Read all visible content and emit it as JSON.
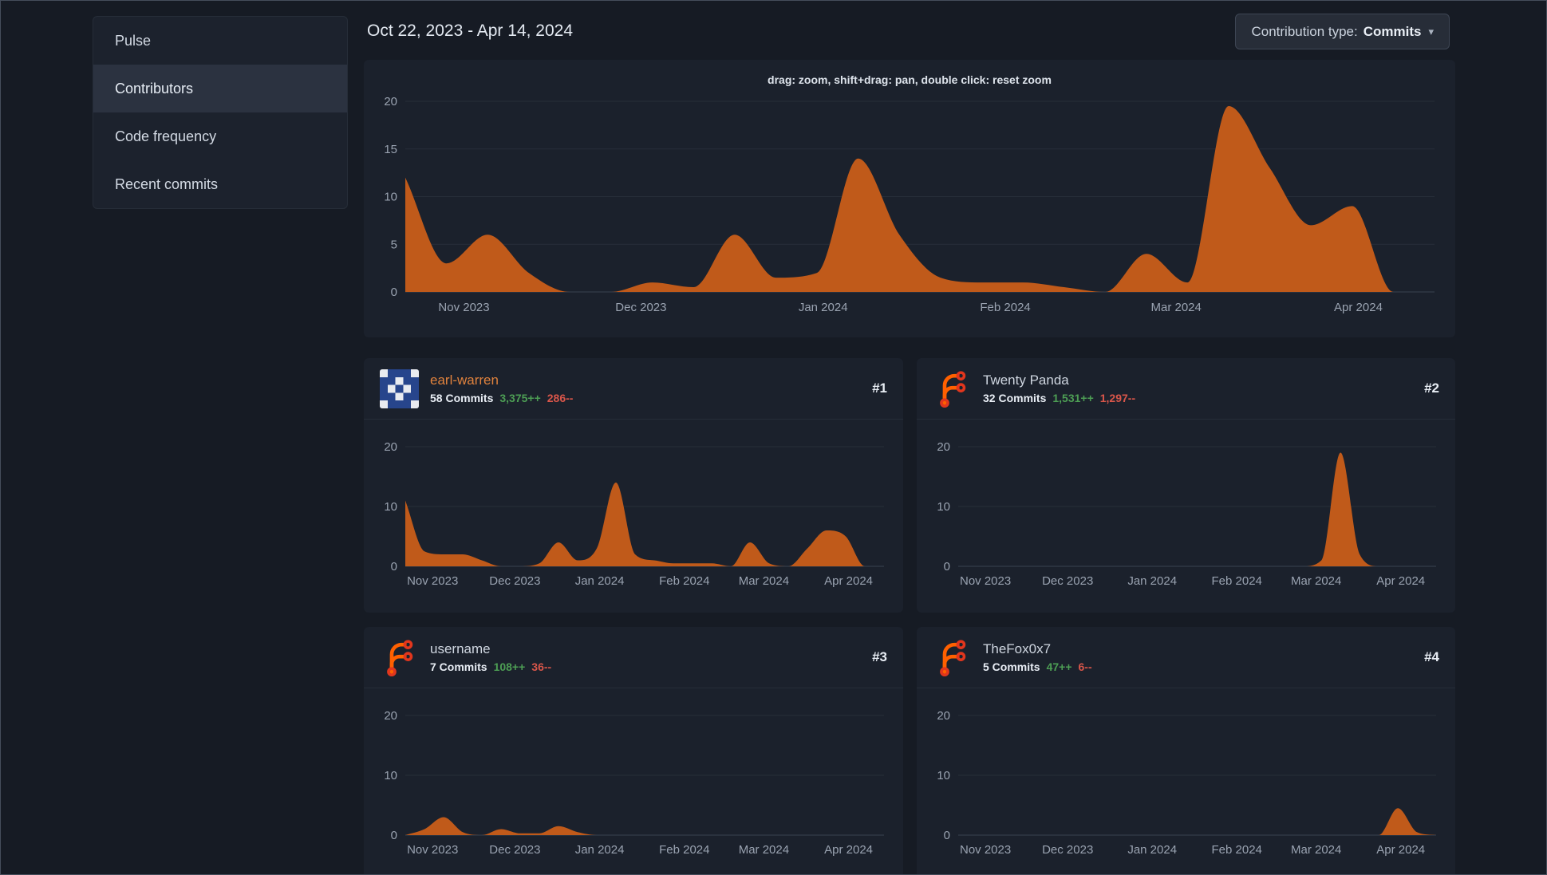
{
  "colors": {
    "page_bg": "#161b24",
    "card_bg": "#1b212c",
    "area": "#c05a1a",
    "grid_line": "#272e39",
    "axis_line": "#3a4250",
    "tick_text": "#9aa3b1",
    "additions_green": "#4d9e54",
    "deletions_red": "#d9564a"
  },
  "sidebar": {
    "items": [
      {
        "label": "Pulse",
        "active": false
      },
      {
        "label": "Contributors",
        "active": true
      },
      {
        "label": "Code frequency",
        "active": false
      },
      {
        "label": "Recent commits",
        "active": false
      }
    ]
  },
  "header": {
    "date_range": "Oct 22, 2023 - Apr 14, 2024",
    "contribution_type_label": "Contribution type:",
    "contribution_type_value": "Commits",
    "chevron_icon": "▾"
  },
  "chart_data": [
    {
      "id": "total-contributions",
      "type": "area",
      "hint": "drag: zoom, shift+drag: pan, double click: reset zoom",
      "week_start": "Oct 22, 2023",
      "week_end": "Apr 14, 2024",
      "x_tick_labels": [
        "Nov 2023",
        "Dec 2023",
        "Jan 2024",
        "Feb 2024",
        "Mar 2024",
        "Apr 2024"
      ],
      "x_tick_positions": [
        0.057,
        0.229,
        0.406,
        0.583,
        0.749,
        0.926
      ],
      "weekly_values": [
        12,
        3,
        6,
        2,
        0,
        0,
        1,
        0.5,
        6,
        1.5,
        2,
        14,
        6,
        1.5,
        1,
        1,
        0.5,
        0,
        4,
        1,
        19.5,
        13,
        7,
        9,
        0,
        0
      ],
      "ylim": [
        0,
        20
      ],
      "yticks": [
        0,
        5,
        10,
        15,
        20
      ]
    },
    {
      "id": "earl-warren",
      "type": "area",
      "name": "earl-warren",
      "name_color": "#e0823d",
      "rank": "#1",
      "commits": "58 Commits",
      "additions": "3,375++",
      "deletions": "286--",
      "x_tick_labels": [
        "Nov 2023",
        "Dec 2023",
        "Jan 2024",
        "Feb 2024",
        "Mar 2024",
        "Apr 2024"
      ],
      "x_tick_positions": [
        0.057,
        0.229,
        0.406,
        0.583,
        0.749,
        0.926
      ],
      "weekly_values": [
        11,
        2.5,
        2,
        2,
        1,
        0,
        0,
        0.5,
        4,
        1,
        3,
        14,
        2,
        1,
        0.5,
        0.5,
        0.5,
        0,
        4,
        0.5,
        0,
        3,
        6,
        5,
        0,
        0
      ],
      "ylim": [
        0,
        20
      ],
      "yticks": [
        0,
        10,
        20
      ]
    },
    {
      "id": "twenty-panda",
      "type": "area",
      "name": "Twenty Panda",
      "name_color": "#cfd6e0",
      "rank": "#2",
      "commits": "32 Commits",
      "additions": "1,531++",
      "deletions": "1,297--",
      "x_tick_labels": [
        "Nov 2023",
        "Dec 2023",
        "Jan 2024",
        "Feb 2024",
        "Mar 2024",
        "Apr 2024"
      ],
      "x_tick_positions": [
        0.057,
        0.229,
        0.406,
        0.583,
        0.749,
        0.926
      ],
      "weekly_values": [
        0,
        0,
        0,
        0,
        0,
        0,
        0,
        0,
        0,
        0,
        0,
        0,
        0,
        0,
        0,
        0,
        0,
        0,
        0,
        1,
        19,
        2,
        0,
        0,
        0,
        0
      ],
      "ylim": [
        0,
        20
      ],
      "yticks": [
        0,
        10,
        20
      ]
    },
    {
      "id": "username",
      "type": "area",
      "name": "username",
      "name_color": "#cfd6e0",
      "rank": "#3",
      "commits": "7 Commits",
      "additions": "108++",
      "deletions": "36--",
      "x_tick_labels": [
        "Nov 2023",
        "Dec 2023",
        "Jan 2024",
        "Feb 2024",
        "Mar 2024",
        "Apr 2024"
      ],
      "x_tick_positions": [
        0.057,
        0.229,
        0.406,
        0.583,
        0.749,
        0.926
      ],
      "weekly_values": [
        0,
        1,
        3,
        0.5,
        0,
        1,
        0.3,
        0.3,
        1.5,
        0.5,
        0,
        0,
        0,
        0,
        0,
        0,
        0,
        0,
        0,
        0,
        0,
        0,
        0,
        0,
        0,
        0
      ],
      "ylim": [
        0,
        20
      ],
      "yticks": [
        0,
        10,
        20
      ]
    },
    {
      "id": "thefox0x7",
      "type": "area",
      "name": "TheFox0x7",
      "name_color": "#cfd6e0",
      "rank": "#4",
      "commits": "5 Commits",
      "additions": "47++",
      "deletions": "6--",
      "x_tick_labels": [
        "Nov 2023",
        "Dec 2023",
        "Jan 2024",
        "Feb 2024",
        "Mar 2024",
        "Apr 2024"
      ],
      "x_tick_positions": [
        0.057,
        0.229,
        0.406,
        0.583,
        0.749,
        0.926
      ],
      "weekly_values": [
        0,
        0,
        0,
        0,
        0,
        0,
        0,
        0,
        0,
        0,
        0,
        0,
        0,
        0,
        0,
        0,
        0,
        0,
        0,
        0,
        0,
        0,
        0,
        4.5,
        0.5,
        0
      ],
      "ylim": [
        0,
        20
      ],
      "yticks": [
        0,
        10,
        20
      ]
    }
  ]
}
